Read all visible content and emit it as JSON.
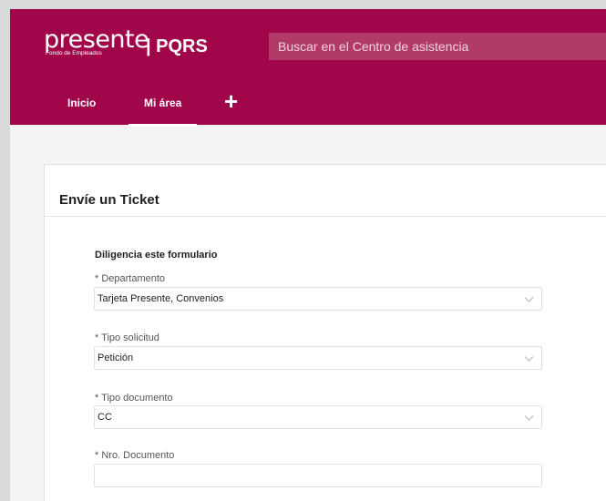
{
  "header": {
    "logo_text": "presente",
    "logo_subtitle": "Fondo de Empleados",
    "section_title": "| PQRS",
    "search_placeholder": "Buscar en el Centro de asistencia"
  },
  "nav": {
    "items": [
      {
        "label": "Inicio",
        "active": false
      },
      {
        "label": "Mi área",
        "active": true
      }
    ],
    "add_icon": "plus-icon",
    "add_symbol": "+"
  },
  "card": {
    "title": "Envíe un Ticket",
    "form_title": "Diligencia este formulario",
    "fields": [
      {
        "label": "* Departamento",
        "value": "Tarjeta Presente, Convenios",
        "type": "select"
      },
      {
        "label": "* Tipo solicitud",
        "value": "Petición",
        "type": "select"
      },
      {
        "label": "* Tipo documento",
        "value": "CC",
        "type": "select"
      },
      {
        "label": "* Nro. Documento",
        "value": "",
        "type": "text"
      }
    ]
  },
  "colors": {
    "brand": "#a1064a",
    "search_bg": "#b23a68"
  }
}
